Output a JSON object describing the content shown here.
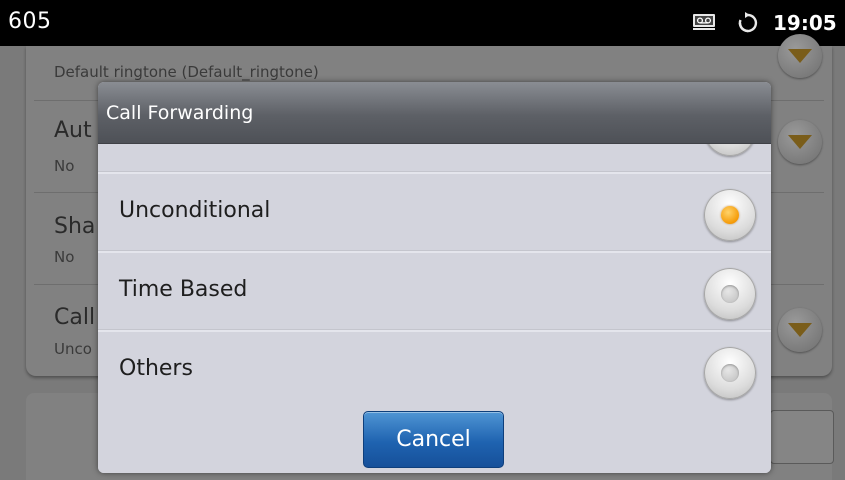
{
  "status_bar": {
    "title": "605",
    "time": "19:05",
    "icons": [
      "voicemail-icon",
      "sync-icon"
    ]
  },
  "background_settings": {
    "rows": [
      {
        "title": "",
        "subtitle": "Default ringtone (Default_ringtone)"
      },
      {
        "title": "Aut",
        "subtitle": "No"
      },
      {
        "title": "Sha",
        "subtitle": "No"
      },
      {
        "title": "Call",
        "subtitle": "Unco"
      }
    ]
  },
  "dialog": {
    "title": "Call Forwarding",
    "options": [
      {
        "label": "Unconditional",
        "selected": true
      },
      {
        "label": "Time Based",
        "selected": false
      },
      {
        "label": "Others",
        "selected": false
      }
    ],
    "cancel_label": "Cancel"
  },
  "colors": {
    "accent_orange": "#f59b07",
    "button_blue": "#1f63b0",
    "dialog_bg": "#d3d4dd",
    "status_bar_bg": "#000000"
  }
}
